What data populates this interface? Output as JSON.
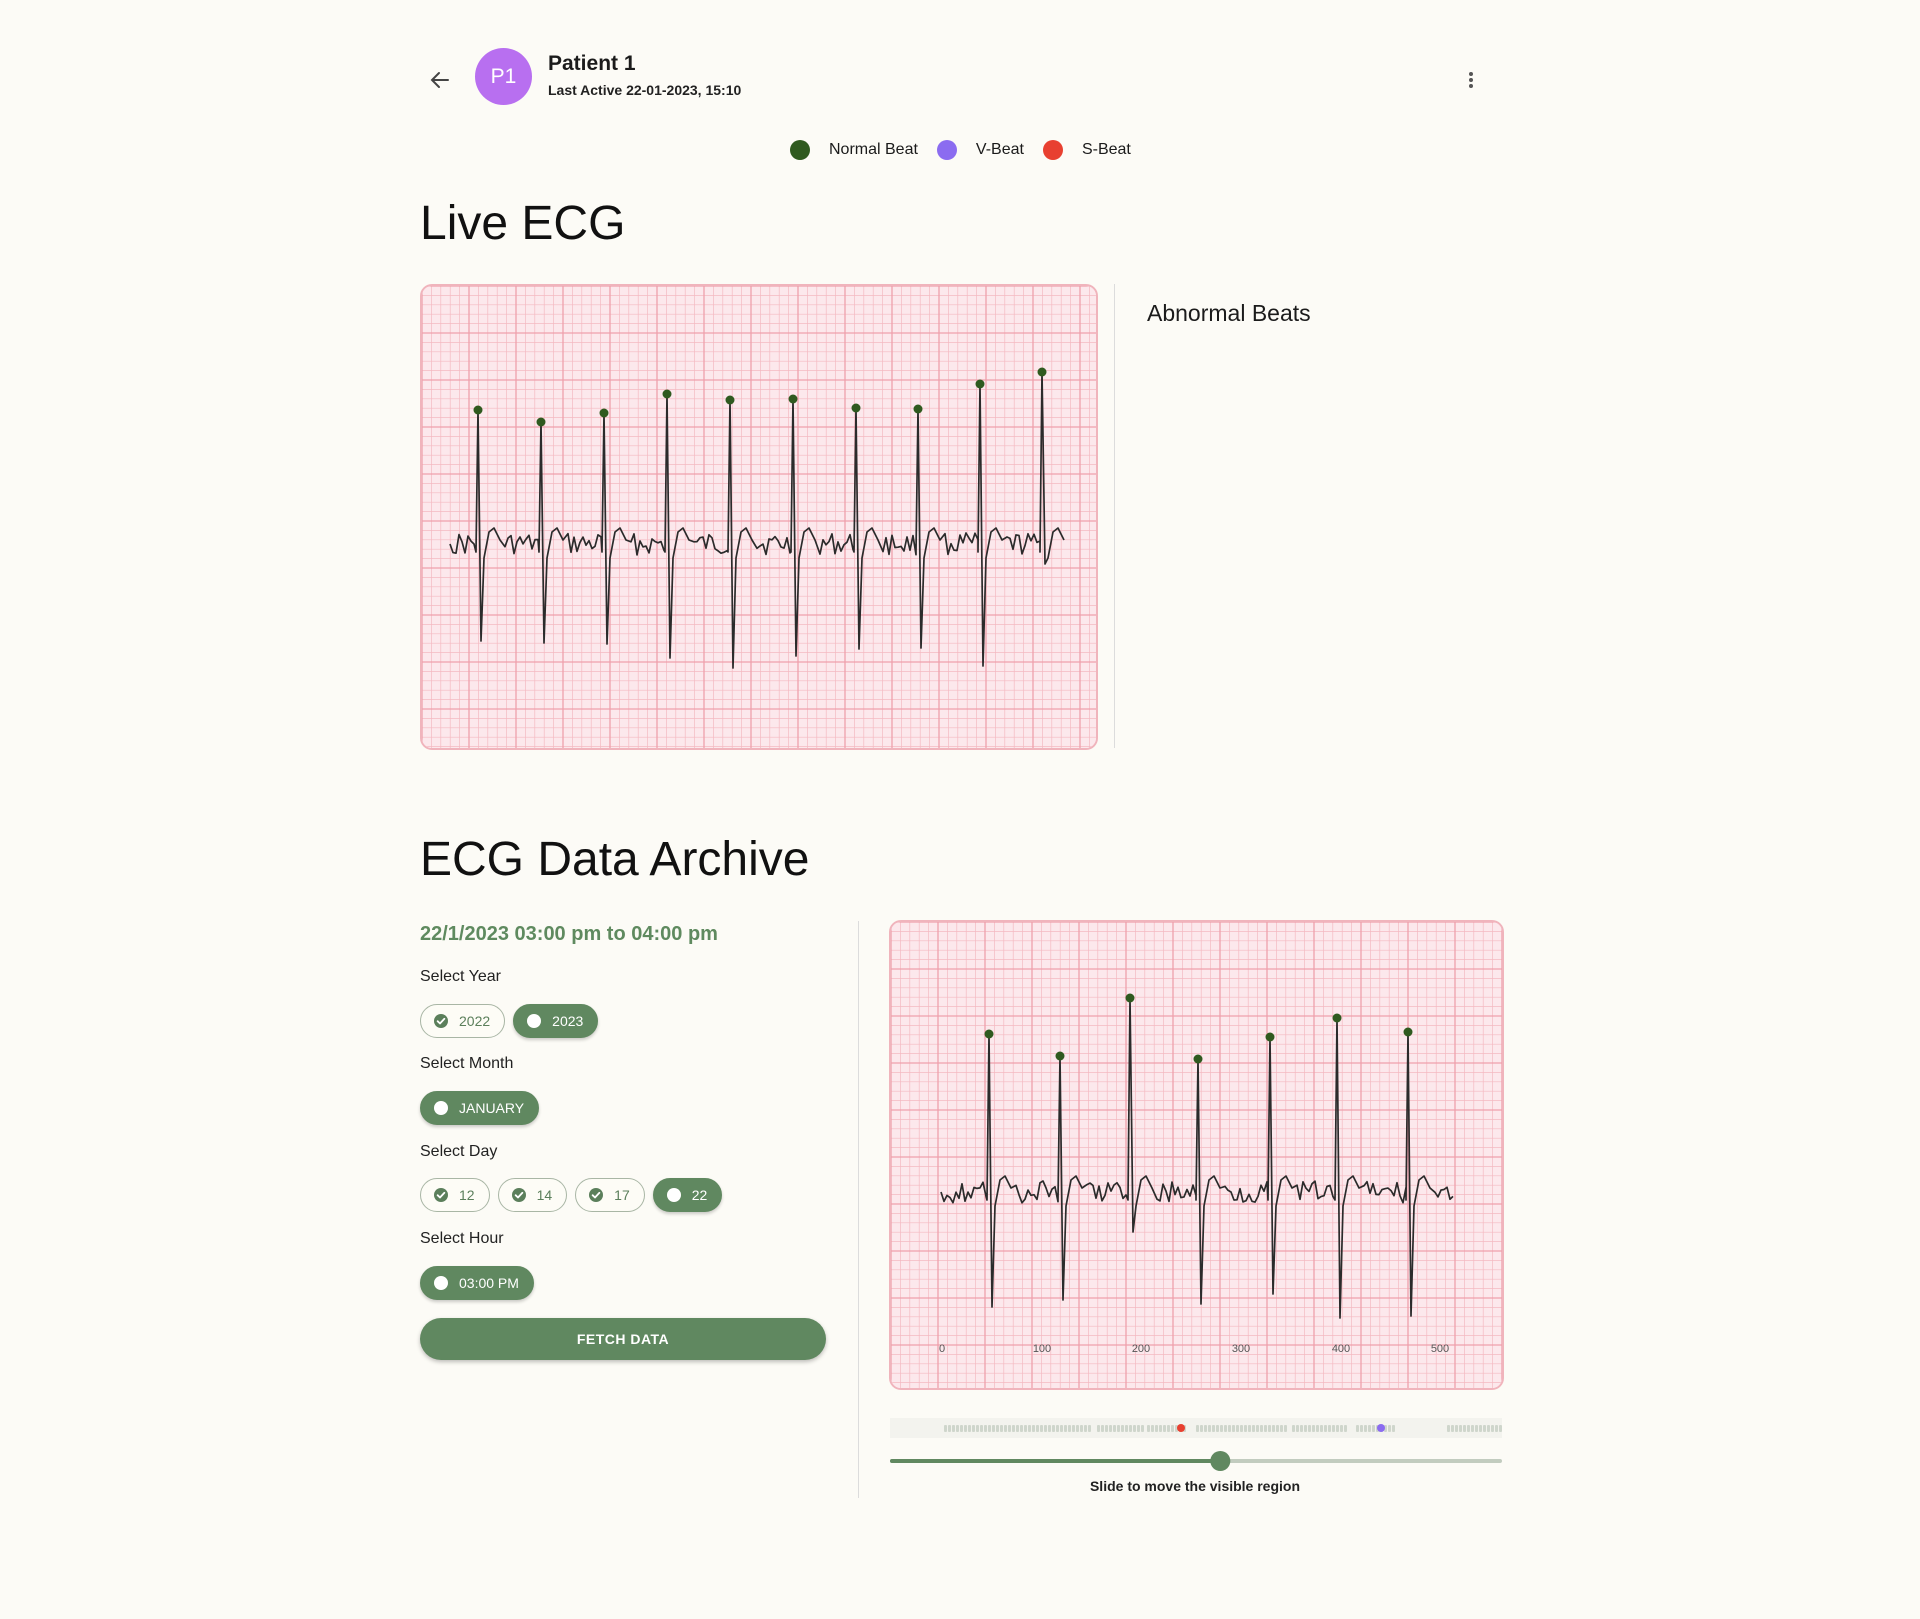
{
  "header": {
    "avatar_initials": "P1",
    "patient_name": "Patient 1",
    "last_active": "Last Active 22-01-2023, 15:10"
  },
  "legend": [
    {
      "label": "Normal Beat",
      "color": "#2f5a1f"
    },
    {
      "label": "V-Beat",
      "color": "#8b6cf0"
    },
    {
      "label": "S-Beat",
      "color": "#e84030"
    }
  ],
  "live": {
    "title": "Live ECG",
    "abnormal_title": "Abnormal Beats"
  },
  "archive": {
    "title": "ECG Data Archive",
    "range": "22/1/2023 03:00 pm to 04:00 pm",
    "year_label": "Select Year",
    "years": [
      {
        "label": "2022",
        "selected": false
      },
      {
        "label": "2023",
        "selected": true
      }
    ],
    "month_label": "Select Month",
    "months": [
      {
        "label": "JANUARY",
        "selected": true
      }
    ],
    "day_label": "Select Day",
    "days": [
      {
        "label": "12",
        "selected": false
      },
      {
        "label": "14",
        "selected": false
      },
      {
        "label": "17",
        "selected": false
      },
      {
        "label": "22",
        "selected": true
      }
    ],
    "hour_label": "Select Hour",
    "hours": [
      {
        "label": "03:00 PM",
        "selected": true
      }
    ],
    "fetch_label": "FETCH DATA",
    "x_ticks": [
      "0",
      "100",
      "200",
      "300",
      "400",
      "500"
    ],
    "slider_value": 0.54,
    "slider_label": "Slide to move the visible region"
  },
  "colors": {
    "accent": "#608860",
    "grid_bg": "#fce8ec",
    "grid_minor": "#f4b9c1",
    "grid_major": "#eea0ac",
    "trace": "#2b2b2b",
    "normal_beat": "#2f5a1f"
  }
}
